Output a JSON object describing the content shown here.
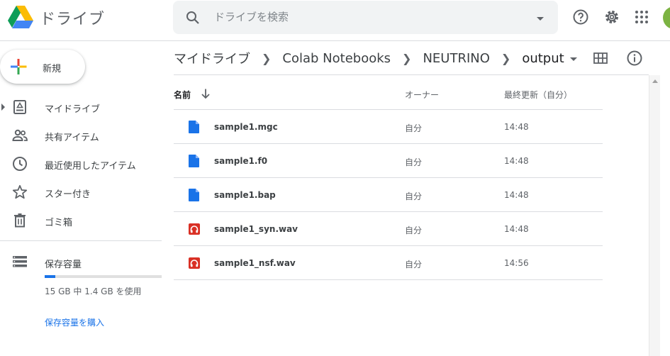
{
  "app": {
    "name": "ドライブ"
  },
  "search": {
    "placeholder": "ドライブを検索"
  },
  "sidebar": {
    "new_label": "新規",
    "items": [
      {
        "label": "マイドライブ",
        "icon": "my-drive-icon"
      },
      {
        "label": "共有アイテム",
        "icon": "shared-icon"
      },
      {
        "label": "最近使用したアイテム",
        "icon": "clock-icon"
      },
      {
        "label": "スター付き",
        "icon": "star-icon"
      },
      {
        "label": "ゴミ箱",
        "icon": "trash-icon"
      }
    ],
    "storage": {
      "label": "保存容量",
      "usage": "15 GB 中 1.4 GB を使用",
      "used_fraction": 0.093,
      "buy": "保存容量を購入"
    }
  },
  "breadcrumb": [
    "マイドライブ",
    "Colab Notebooks",
    "NEUTRINO",
    "output"
  ],
  "list": {
    "col_name": "名前",
    "col_owner": "オーナー",
    "col_modified": "最終更新（自分）",
    "rows": [
      {
        "name": "sample1.mgc",
        "owner": "自分",
        "modified": "14:48",
        "type": "doc"
      },
      {
        "name": "sample1.f0",
        "owner": "自分",
        "modified": "14:48",
        "type": "doc"
      },
      {
        "name": "sample1.bap",
        "owner": "自分",
        "modified": "14:48",
        "type": "doc"
      },
      {
        "name": "sample1_syn.wav",
        "owner": "自分",
        "modified": "14:48",
        "type": "audio"
      },
      {
        "name": "sample1_nsf.wav",
        "owner": "自分",
        "modified": "14:56",
        "type": "audio"
      }
    ]
  },
  "colors": {
    "accent": "#1a73e8",
    "doc": "#1a73e8",
    "audio": "#d93025",
    "avatar": "#7cb342"
  }
}
